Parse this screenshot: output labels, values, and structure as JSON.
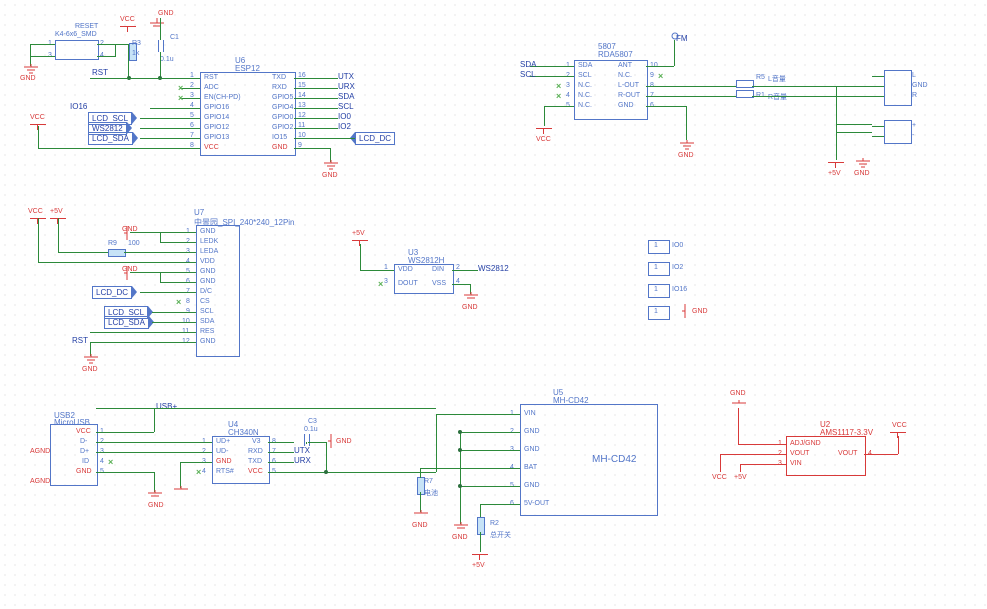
{
  "power": {
    "vcc": "VCC",
    "gnd": "GND",
    "agnd": "AGND",
    "p5v": "+5V"
  },
  "nets": {
    "lcd_scl": "LCD_SCL",
    "lcd_sda": "LCD_SDA",
    "lcd_dc": "LCD_DC",
    "ws2812": "WS2812",
    "io0": "IO0",
    "io2": "IO2",
    "io16": "IO16",
    "rst": "RST",
    "utx": "UTX",
    "urx": "URX",
    "sda": "SDA",
    "scl": "SCL",
    "fm": "FM",
    "reset": "RESET",
    "usb_plus": "USB+"
  },
  "parts": {
    "u6": {
      "ref": "U6",
      "val": "ESP12",
      "left_pins": [
        "RST",
        "ADC",
        "EN(CH-PD)",
        "GPIO16",
        "GPIO14",
        "GPIO12",
        "GPIO13",
        "VCC"
      ],
      "right_pins": [
        "TXD",
        "RXD",
        "GPIO5",
        "GPIO4",
        "GPIO0",
        "GPIO2",
        "IO15",
        "GND"
      ],
      "left_nums": [
        "1",
        "2",
        "3",
        "4",
        "5",
        "6",
        "7",
        "8"
      ],
      "right_nums": [
        "16",
        "15",
        "14",
        "13",
        "12",
        "11",
        "10",
        "9"
      ]
    },
    "r3": {
      "ref": "R3",
      "val": "1k"
    },
    "c1": {
      "ref": "C1",
      "val": "0.1u"
    },
    "k4": {
      "ref": "K4-6x6_SMD",
      "val": ""
    },
    "u7": {
      "ref": "U7",
      "val": "中景园_SPI_240*240_12Pin",
      "pins": [
        "GND",
        "LEDK",
        "LEDA",
        "VDD",
        "GND",
        "GND",
        "D/C",
        "CS",
        "SCL",
        "SDA",
        "RES",
        "GND"
      ],
      "nums": [
        "1",
        "2",
        "3",
        "4",
        "5",
        "6",
        "7",
        "8",
        "9",
        "10",
        "11",
        "12"
      ]
    },
    "r9": {
      "ref": "R9",
      "val": "100"
    },
    "u3": {
      "ref": "U3",
      "val": "WS2812H",
      "left": [
        "VDD",
        "DOUT"
      ],
      "right": [
        "DIN",
        "VSS"
      ],
      "lnum": [
        "1",
        "3"
      ],
      "rnum": [
        "2",
        "4"
      ]
    },
    "hdr_right": {
      "labels": [
        "IO0",
        "IO2",
        "IO16",
        "GND"
      ]
    },
    "rda5807": {
      "ref": "5807",
      "val": "RDA5807",
      "left": [
        "SDA",
        "SCL",
        "N.C.",
        "N.C.",
        "N.C."
      ],
      "lnum": [
        "1",
        "2",
        "3",
        "4",
        "5"
      ],
      "right": [
        "ANT",
        "N.C.",
        "L-OUT",
        "R-OUT",
        "GND"
      ],
      "rnum": [
        "10",
        "9",
        "8",
        "7",
        "6"
      ]
    },
    "r5": {
      "ref": "R5",
      "val": "L音量"
    },
    "r1": {
      "ref": "R1",
      "val": "R音量"
    },
    "conn_lr": {
      "pins": [
        "L",
        "GND",
        "R"
      ]
    },
    "conn_pm": {
      "pins": [
        "+",
        "-"
      ]
    },
    "usb2": {
      "ref": "USB2",
      "val": "MicroUSB",
      "pins": [
        "VCC",
        "D-",
        "D+",
        "ID",
        "GND"
      ],
      "nums": [
        "1",
        "2",
        "3",
        "4",
        "5"
      ]
    },
    "u4": {
      "ref": "U4",
      "val": "CH340N",
      "left": [
        "UD+",
        "UD-",
        "GND",
        "RTS#"
      ],
      "lnum": [
        "1",
        "2",
        "3",
        "4"
      ],
      "right": [
        "V3",
        "RXD",
        "TXD",
        "VCC"
      ],
      "rnum": [
        "8",
        "7",
        "6",
        "5"
      ]
    },
    "c3": {
      "ref": "C3",
      "val": "0.1u"
    },
    "r7": {
      "ref": "R7",
      "val": "电池"
    },
    "r2": {
      "ref": "R2",
      "val": "总开关"
    },
    "u5": {
      "ref": "U5",
      "val": "MH-CD42",
      "big": "MH-CD42",
      "pins": [
        "VIN",
        "GND",
        "GND",
        "BAT",
        "GND",
        "5V-OUT"
      ],
      "nums": [
        "1",
        "2",
        "3",
        "4",
        "5",
        "6"
      ]
    },
    "u2": {
      "ref": "U2",
      "val": "AMS1117-3.3V",
      "left": [
        "ADJ/GND",
        "VOUT",
        "VIN"
      ],
      "lnum": [
        "1",
        "2",
        "3"
      ],
      "right": [
        "VOUT"
      ],
      "rnum": [
        "4"
      ]
    }
  },
  "colors": {
    "wire": "#2c8a3a",
    "part": "#5376c8",
    "power": "#d83a3a",
    "net": "#2540a5"
  }
}
